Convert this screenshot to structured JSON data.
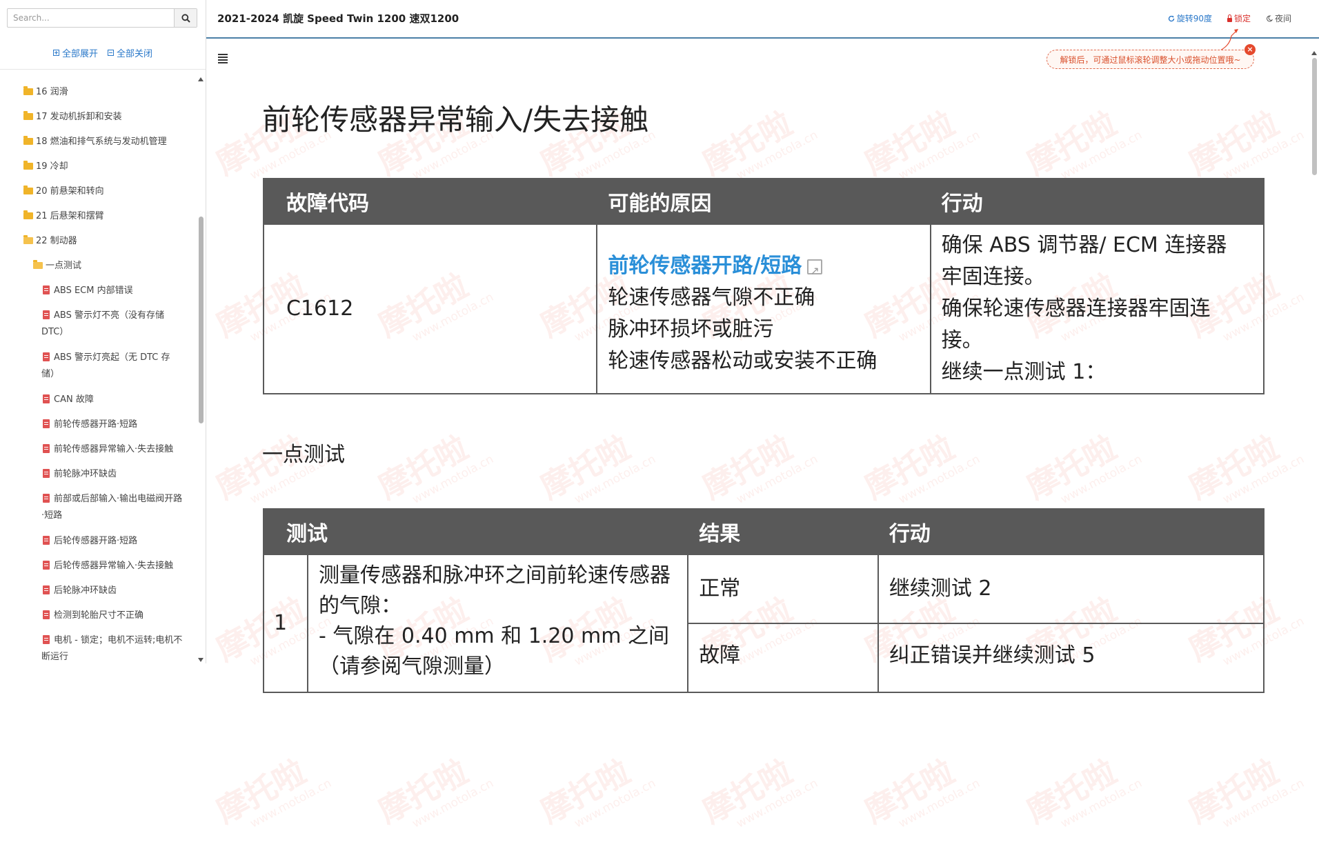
{
  "sidebar": {
    "search_placeholder": "Search...",
    "expand_all": "全部展开",
    "collapse_all": "全部关闭",
    "folders": [
      "16 润滑",
      "17 发动机拆卸和安装",
      "18 燃油和排气系统与发动机管理",
      "19 冷却",
      "20 前悬架和转向",
      "21 后悬架和摆臂",
      "22 制动器"
    ],
    "subfolder": "一点测试",
    "docs": [
      {
        "line1": "ABS ECM 内部错误",
        "line2": ""
      },
      {
        "line1": "ABS 警示灯不亮（没有存储",
        "line2": "DTC）"
      },
      {
        "line1": "ABS 警示灯亮起（无 DTC 存",
        "line2": "储）"
      },
      {
        "line1": "CAN 故障",
        "line2": ""
      },
      {
        "line1": "前轮传感器开路·短路",
        "line2": ""
      },
      {
        "line1": "前轮传感器异常输入·失去接触",
        "line2": ""
      },
      {
        "line1": "前轮脉冲环缺齿",
        "line2": ""
      },
      {
        "line1": "前部或后部输入·输出电磁阀开路",
        "line2": "·短路"
      },
      {
        "line1": "后轮传感器开路·短路",
        "line2": ""
      },
      {
        "line1": "后轮传感器异常输入·失去接触",
        "line2": ""
      },
      {
        "line1": "后轮脉冲环缺齿",
        "line2": ""
      },
      {
        "line1": "检测到轮胎尺寸不正确",
        "line2": ""
      },
      {
        "line1": "电机 - 锁定；电机不运转;电机不",
        "line2": "断运行"
      }
    ]
  },
  "header": {
    "title": "2021-2024 凯旋 Speed Twin 1200 速双1200",
    "rotate": "旋转90度",
    "lock": "锁定",
    "night": "夜间",
    "tooltip": "解锁后，可通过鼠标滚轮调整大小或拖动位置哦~"
  },
  "content": {
    "title": "前轮传感器异常输入/失去接触",
    "cause_table": {
      "headers": [
        "故障代码",
        "可能的原因",
        "行动"
      ],
      "code": "C1612",
      "cause_link": "前轮传感器开路/短路",
      "causes": [
        "轮速传感器气隙不正确",
        "脉冲环损坏或脏污",
        "轮速传感器松动或安装不正确"
      ],
      "actions": [
        "确保 ABS 调节器/ ECM 连接器",
        "牢固连接。",
        "确保轮速传感器连接器牢固连",
        "接。",
        "继续一点测试 1："
      ]
    },
    "section_title": "一点测试",
    "test_table": {
      "headers": [
        "测试",
        "结果",
        "行动"
      ],
      "num": "1",
      "test_lines": [
        "测量传感器和脉冲环之间前轮速传感器",
        "的气隙：",
        "- 气隙在 0.40 mm 和 1.20 mm 之间",
        "（请参阅气隙测量）"
      ],
      "results": [
        "正常",
        "故障"
      ],
      "actions": [
        "继续测试 2",
        "纠正错误并继续测试 5"
      ]
    },
    "watermark": {
      "cn": "摩托啦",
      "url": "www.motola.cn"
    }
  }
}
